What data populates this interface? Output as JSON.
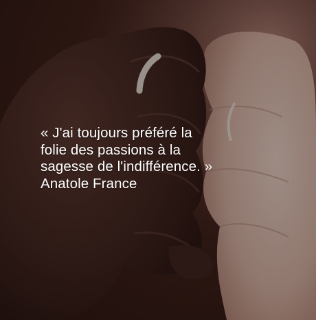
{
  "quote": {
    "lines": [
      "« J'ai toujours préféré la",
      "folie des passions à la",
      "sagesse de l'indifférence. »"
    ],
    "author": "Anatole France"
  },
  "photo": {
    "subject": "hands-intertwined",
    "colors": {
      "dark_skin": "#3b2520",
      "light_skin": "#e9d2c6",
      "background": "#2a1712",
      "ring": "#f2efe8"
    }
  }
}
